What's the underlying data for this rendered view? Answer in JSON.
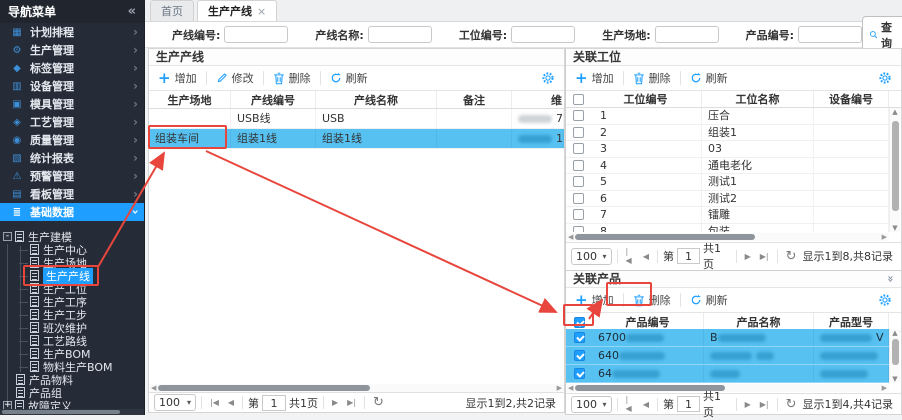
{
  "icons": {
    "collapse-left-icon": "«",
    "chevron-right-icon": "›",
    "calendar-icon": "▦",
    "production-gear-icon": "⚙",
    "tag-icon": "◆",
    "equipment-icon": "▥",
    "mold-icon": "▣",
    "craft-icon": "◈",
    "quality-icon": "◉",
    "report-chart-icon": "▧",
    "alert-icon": "⚠",
    "kanban-icon": "▤",
    "base-data-icon": "≣",
    "tab-close-icon": "×",
    "plus-icon": "+",
    "caret-down-icon": "▾",
    "first-page-icon": "|◀",
    "prev-page-icon": "◀",
    "next-page-icon": "▶",
    "last-page-icon": "▶|",
    "pager-refresh-icon": "↻",
    "scroll-up-icon": "▲",
    "scroll-down-icon": "▼",
    "scroll-left-icon": "◀",
    "scroll-right-icon": "▶",
    "collapse-panel-icon": "«",
    "tree-collapse-glyph": "-",
    "tree-expand-glyph": "+"
  },
  "sidebar": {
    "title": "导航菜单",
    "menu": [
      {
        "label": "计划排程",
        "icon": "calendar-icon",
        "active": false
      },
      {
        "label": "生产管理",
        "icon": "production-gear-icon",
        "active": false
      },
      {
        "label": "标签管理",
        "icon": "tag-icon",
        "active": false
      },
      {
        "label": "设备管理",
        "icon": "equipment-icon",
        "active": false
      },
      {
        "label": "模具管理",
        "icon": "mold-icon",
        "active": false
      },
      {
        "label": "工艺管理",
        "icon": "craft-icon",
        "active": false
      },
      {
        "label": "质量管理",
        "icon": "quality-icon",
        "active": false
      },
      {
        "label": "统计报表",
        "icon": "report-chart-icon",
        "active": false
      },
      {
        "label": "预警管理",
        "icon": "alert-icon",
        "active": false
      },
      {
        "label": "看板管理",
        "icon": "kanban-icon",
        "active": false
      },
      {
        "label": "基础数据",
        "icon": "base-data-icon",
        "active": true
      }
    ],
    "tree": {
      "root": "生产建模",
      "children": [
        "生产中心",
        "生产场地",
        "生产产线",
        "生产工位",
        "生产工序",
        "生产工步",
        "班次维护",
        "工艺路线",
        "生产BOM",
        "物料生产BOM"
      ],
      "selected_index": 2,
      "others": [
        "产品物料",
        "产品组",
        "故障定义"
      ]
    }
  },
  "tabs": [
    {
      "label": "首页",
      "active": false
    },
    {
      "label": "生产产线",
      "active": true
    }
  ],
  "search": {
    "fields": [
      {
        "label": "产线编号:"
      },
      {
        "label": "产线名称:"
      },
      {
        "label": "工位编号:"
      },
      {
        "label": "生产场地:"
      },
      {
        "label": "产品编号:"
      }
    ],
    "button": "查询"
  },
  "line_panel": {
    "title": "生产产线",
    "toolbar": {
      "add": "增加",
      "edit": "修改",
      "delete": "删除",
      "refresh": "刷新"
    },
    "columns": [
      "生产场地",
      "产线编号",
      "产线名称",
      "备注",
      "维"
    ],
    "rows": [
      {
        "site": "",
        "code": "USB线",
        "name": "USB",
        "note": "",
        "tail": "7",
        "selected": false
      },
      {
        "site": "组装车间",
        "code": "组装1线",
        "name": "组装1线",
        "note": "",
        "tail": "1",
        "selected": true
      }
    ],
    "pager": {
      "page_size": "100",
      "page_prefix": "第",
      "page": "1",
      "page_total": "共1页",
      "info": "显示1到2,共2记录"
    }
  },
  "station_panel": {
    "title": "关联工位",
    "toolbar": {
      "add": "增加",
      "delete": "删除",
      "refresh": "刷新"
    },
    "columns": [
      "工位编号",
      "工位名称",
      "设备编号"
    ],
    "rows": [
      {
        "no": "1",
        "name": "压合",
        "device": ""
      },
      {
        "no": "2",
        "name": "组装1",
        "device": ""
      },
      {
        "no": "3",
        "name": "03",
        "device": ""
      },
      {
        "no": "4",
        "name": "通电老化",
        "device": ""
      },
      {
        "no": "5",
        "name": "测试1",
        "device": ""
      },
      {
        "no": "6",
        "name": "测试2",
        "device": ""
      },
      {
        "no": "7",
        "name": "镭雕",
        "device": ""
      },
      {
        "no": "8",
        "name": "包装",
        "device": ""
      }
    ],
    "pager": {
      "page_size": "100",
      "page_prefix": "第",
      "page": "1",
      "page_total": "共1页",
      "info": "显示1到8,共8记录"
    }
  },
  "product_panel": {
    "title": "关联产品",
    "toolbar": {
      "add": "增加",
      "delete": "删除",
      "refresh": "刷新"
    },
    "columns": [
      "产品编号",
      "产品名称",
      "产品型号"
    ],
    "rows": [
      {
        "code_prefix": "6700",
        "name_prefix": "B",
        "model_suffix": "V",
        "checked": true
      },
      {
        "code_prefix": "640",
        "name_prefix": "",
        "model_suffix": "",
        "checked": true
      },
      {
        "code_prefix": "64",
        "name_prefix": "",
        "model_suffix": "",
        "checked": true
      }
    ],
    "pager": {
      "page_size": "100",
      "page_prefix": "第",
      "page": "1",
      "page_total": "共1页",
      "info": "显示1到4,共4记录"
    }
  }
}
